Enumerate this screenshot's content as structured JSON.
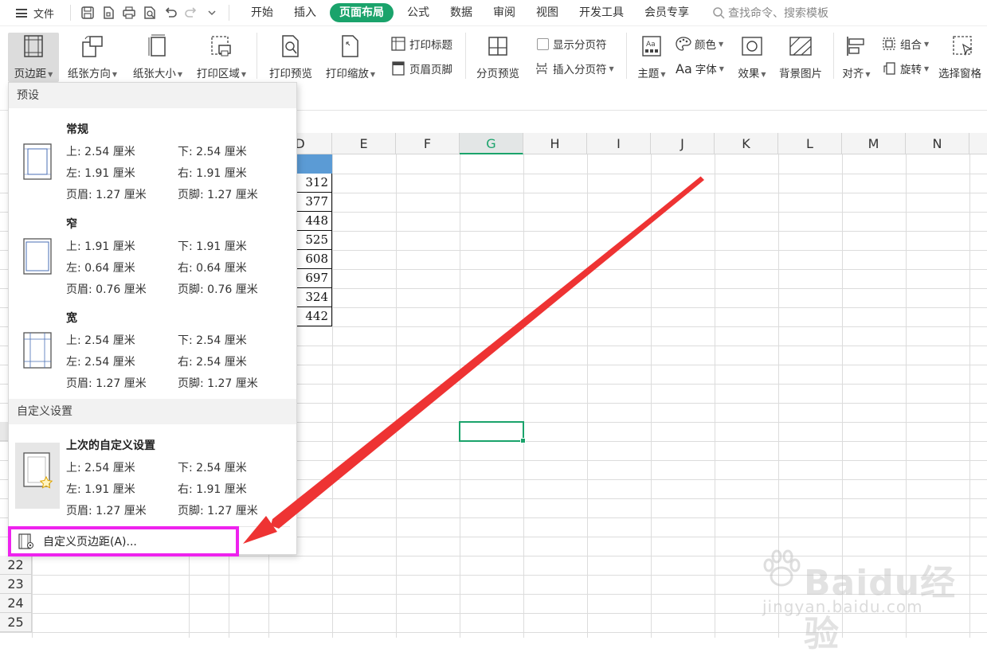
{
  "menubar": {
    "file_label": "文件",
    "tabs": [
      {
        "label": "开始"
      },
      {
        "label": "插入"
      },
      {
        "label": "页面布局",
        "active": true
      },
      {
        "label": "公式"
      },
      {
        "label": "数据"
      },
      {
        "label": "审阅"
      },
      {
        "label": "视图"
      },
      {
        "label": "开发工具"
      },
      {
        "label": "会员专享"
      }
    ],
    "search_placeholder": "查找命令、搜索模板"
  },
  "ribbon": {
    "margins": "页边距",
    "orientation": "纸张方向",
    "size": "纸张大小",
    "print_area": "打印区域",
    "print_preview": "打印预览",
    "print_scale": "打印缩放",
    "print_titles": "打印标题",
    "header_footer": "页眉页脚",
    "page_break_preview": "分页预览",
    "show_page_breaks": "显示分页符",
    "insert_page_break": "插入分页符",
    "theme": "主题",
    "colors": "颜色",
    "fonts": "字体",
    "fonts_prefix": "Aa",
    "effects": "效果",
    "background": "背景图片",
    "align": "对齐",
    "group": "组合",
    "rotate": "旋转",
    "selection_pane": "选择窗格"
  },
  "grid": {
    "columns": [
      "D",
      "E",
      "F",
      "G",
      "H",
      "I",
      "J",
      "K",
      "L",
      "M",
      "N"
    ],
    "selected_column": "G",
    "values": [
      "312",
      "377",
      "448",
      "525",
      "608",
      "697",
      "324",
      "442"
    ],
    "rows_visible": [
      "22",
      "23",
      "24",
      "25"
    ]
  },
  "dropdown": {
    "preset_header": "预设",
    "custom_header": "自定义设置",
    "presets": [
      {
        "name": "常规",
        "top": "上: 2.54 厘米",
        "bottom": "下: 2.54 厘米",
        "left": "左: 1.91 厘米",
        "right": "右: 1.91 厘米",
        "header": "页眉: 1.27 厘米",
        "footer": "页脚: 1.27 厘米"
      },
      {
        "name": "窄",
        "top": "上: 1.91 厘米",
        "bottom": "下: 1.91 厘米",
        "left": "左: 0.64 厘米",
        "right": "右: 0.64 厘米",
        "header": "页眉: 0.76 厘米",
        "footer": "页脚: 0.76 厘米"
      },
      {
        "name": "宽",
        "top": "上: 2.54 厘米",
        "bottom": "下: 2.54 厘米",
        "left": "左: 2.54 厘米",
        "right": "右: 2.54 厘米",
        "header": "页眉: 1.27 厘米",
        "footer": "页脚: 1.27 厘米"
      }
    ],
    "last_custom": {
      "name": "上次的自定义设置",
      "top": "上: 2.54 厘米",
      "bottom": "下: 2.54 厘米",
      "left": "左: 1.91 厘米",
      "right": "右: 1.91 厘米",
      "header": "页眉: 1.27 厘米",
      "footer": "页脚: 1.27 厘米"
    },
    "custom_margins_item": "自定义页边距(A)..."
  },
  "annotation": {
    "highlight_color": "#ee22ee",
    "arrow_color": "#ee3333"
  },
  "watermark": {
    "brand": "Baidu经验",
    "url": "jingyan.baidu.com"
  }
}
